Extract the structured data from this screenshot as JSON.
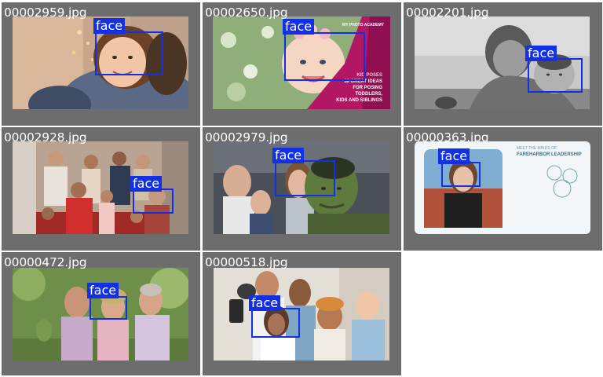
{
  "colors": {
    "cell_bg": "#6d6d6d",
    "box": "#1230e6",
    "label_text": "#ffffff"
  },
  "detections_label": "face",
  "cells": [
    {
      "filename": "00002959.jpg",
      "scene": "girl hugging adult by christmas tree"
    },
    {
      "filename": "00002650.jpg",
      "scene": "smiling baby with flower crown, pink banner",
      "banner": {
        "brand": "MY PHOTO ACADEMY",
        "line1": "KID POSES",
        "line2": "18 GREAT IDEAS",
        "line3": "FOR POSING",
        "line4": "TODDLERS,",
        "line5": "KIDS AND SIBLINGS"
      }
    },
    {
      "filename": "00002201.jpg",
      "scene": "black and white mother carrying baby"
    },
    {
      "filename": "00002928.jpg",
      "scene": "large family group photo"
    },
    {
      "filename": "00002979.jpg",
      "scene": "teens smiling next to green giant"
    },
    {
      "filename": "00000363.jpg",
      "scene": "card with woman portrait in desert",
      "card": {
        "line1": "MEET THE MINDS OF",
        "line2": "FAREHARBOR LEADERSHIP"
      }
    },
    {
      "filename": "00000472.jpg",
      "scene": "friends covered in holi color powder"
    },
    {
      "filename": "00000518.jpg",
      "scene": "group of friends taking selfie"
    }
  ]
}
